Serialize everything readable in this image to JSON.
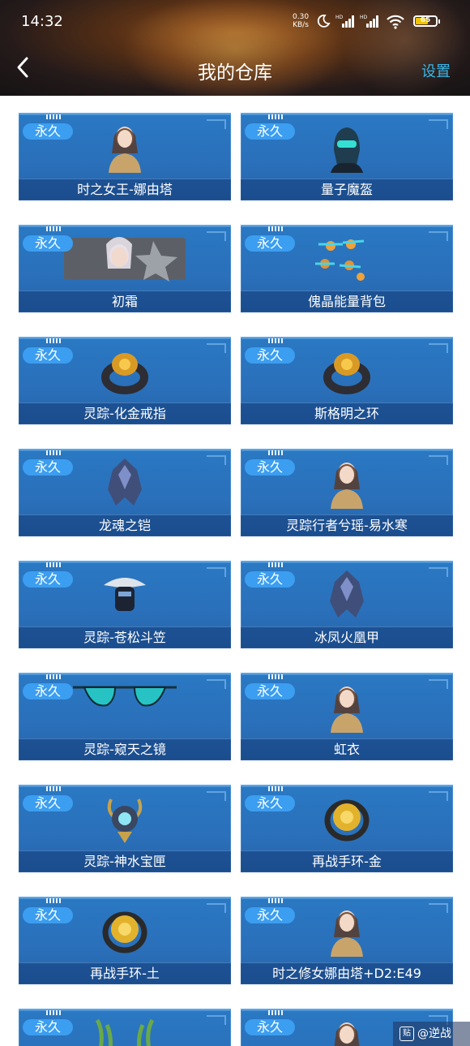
{
  "status_bar": {
    "time": "14:32",
    "speed_value": "0.30",
    "speed_unit": "KB/s",
    "battery": "65"
  },
  "header": {
    "title": "我的仓库",
    "settings_label": "设置",
    "back_icon": "chevron-left-icon"
  },
  "badge_label": "永久",
  "items": [
    {
      "name": "时之女王-娜由塔",
      "icon": "character-portrait-icon"
    },
    {
      "name": "量子魔盔",
      "icon": "helmet-icon"
    },
    {
      "name": "初霜",
      "icon": "weapon-skin-icon"
    },
    {
      "name": "傀晶能量背包",
      "icon": "backpack-icon"
    },
    {
      "name": "灵踪-化金戒指",
      "icon": "ring-icon"
    },
    {
      "name": "斯格明之环",
      "icon": "ring-icon"
    },
    {
      "name": "龙魂之铠",
      "icon": "armor-icon"
    },
    {
      "name": "灵踪行者兮瑶-易水寒",
      "icon": "character-portrait-icon"
    },
    {
      "name": "灵踪-苍松斗笠",
      "icon": "hat-icon"
    },
    {
      "name": "冰凤火凰甲",
      "icon": "armor-icon"
    },
    {
      "name": "灵踪-窥天之镜",
      "icon": "glasses-icon"
    },
    {
      "name": "虹衣",
      "icon": "character-portrait-icon"
    },
    {
      "name": "灵踪-神水宝匣",
      "icon": "box-icon"
    },
    {
      "name": "再战手环-金",
      "icon": "bracelet-icon"
    },
    {
      "name": "再战手环-土",
      "icon": "bracelet-icon"
    },
    {
      "name": "时之修女娜由塔+D2:E49",
      "icon": "character-portrait-icon"
    },
    {
      "name": "",
      "icon": "antler-icon"
    },
    {
      "name": "",
      "icon": "character-portrait-icon"
    }
  ],
  "colors": {
    "card_blue": "#2a6fb9",
    "badge_blue": "#3c9ef0",
    "settings_cyan": "#39b7e8",
    "battery_yellow": "#f0c400"
  },
  "watermark": {
    "icon_char": "贴",
    "text": "@逆战"
  }
}
